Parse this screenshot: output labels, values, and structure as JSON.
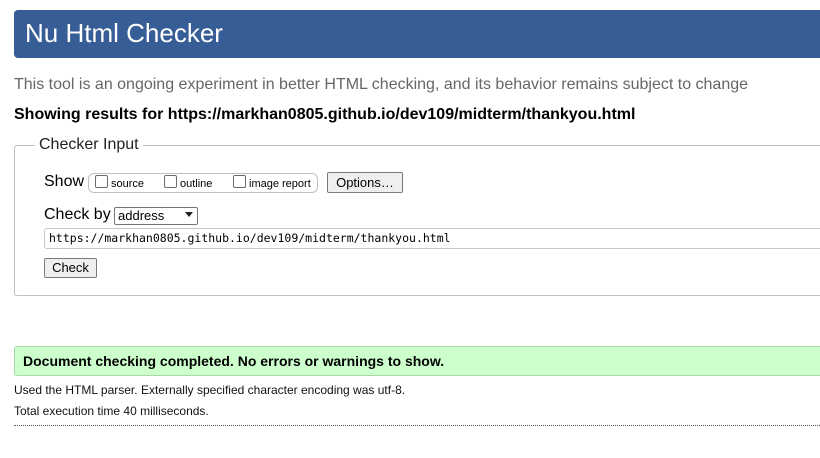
{
  "header": {
    "title": "Nu Html Checker"
  },
  "intro": {
    "subtitle": "This tool is an ongoing experiment in better HTML checking, and its behavior remains subject to change",
    "showing_results": "Showing results for https://markhan0805.github.io/dev109/midterm/thankyou.html"
  },
  "checker_input": {
    "legend": "Checker Input",
    "show_label": "Show",
    "show_options": [
      {
        "label": "source",
        "checked": false
      },
      {
        "label": "outline",
        "checked": false
      },
      {
        "label": "image report",
        "checked": false
      }
    ],
    "options_button": "Options…",
    "check_by_label": "Check by",
    "check_by_selected": "address",
    "url_value": "https://markhan0805.github.io/dev109/midterm/thankyou.html",
    "check_button": "Check"
  },
  "results": {
    "success_message": "Document checking completed. No errors or warnings to show.",
    "parser_note": "Used the HTML parser. Externally specified character encoding was utf-8.",
    "timing_note": "Total execution time 40 milliseconds."
  },
  "colors": {
    "banner": "#365d95",
    "success_bg": "#ccffcc"
  }
}
